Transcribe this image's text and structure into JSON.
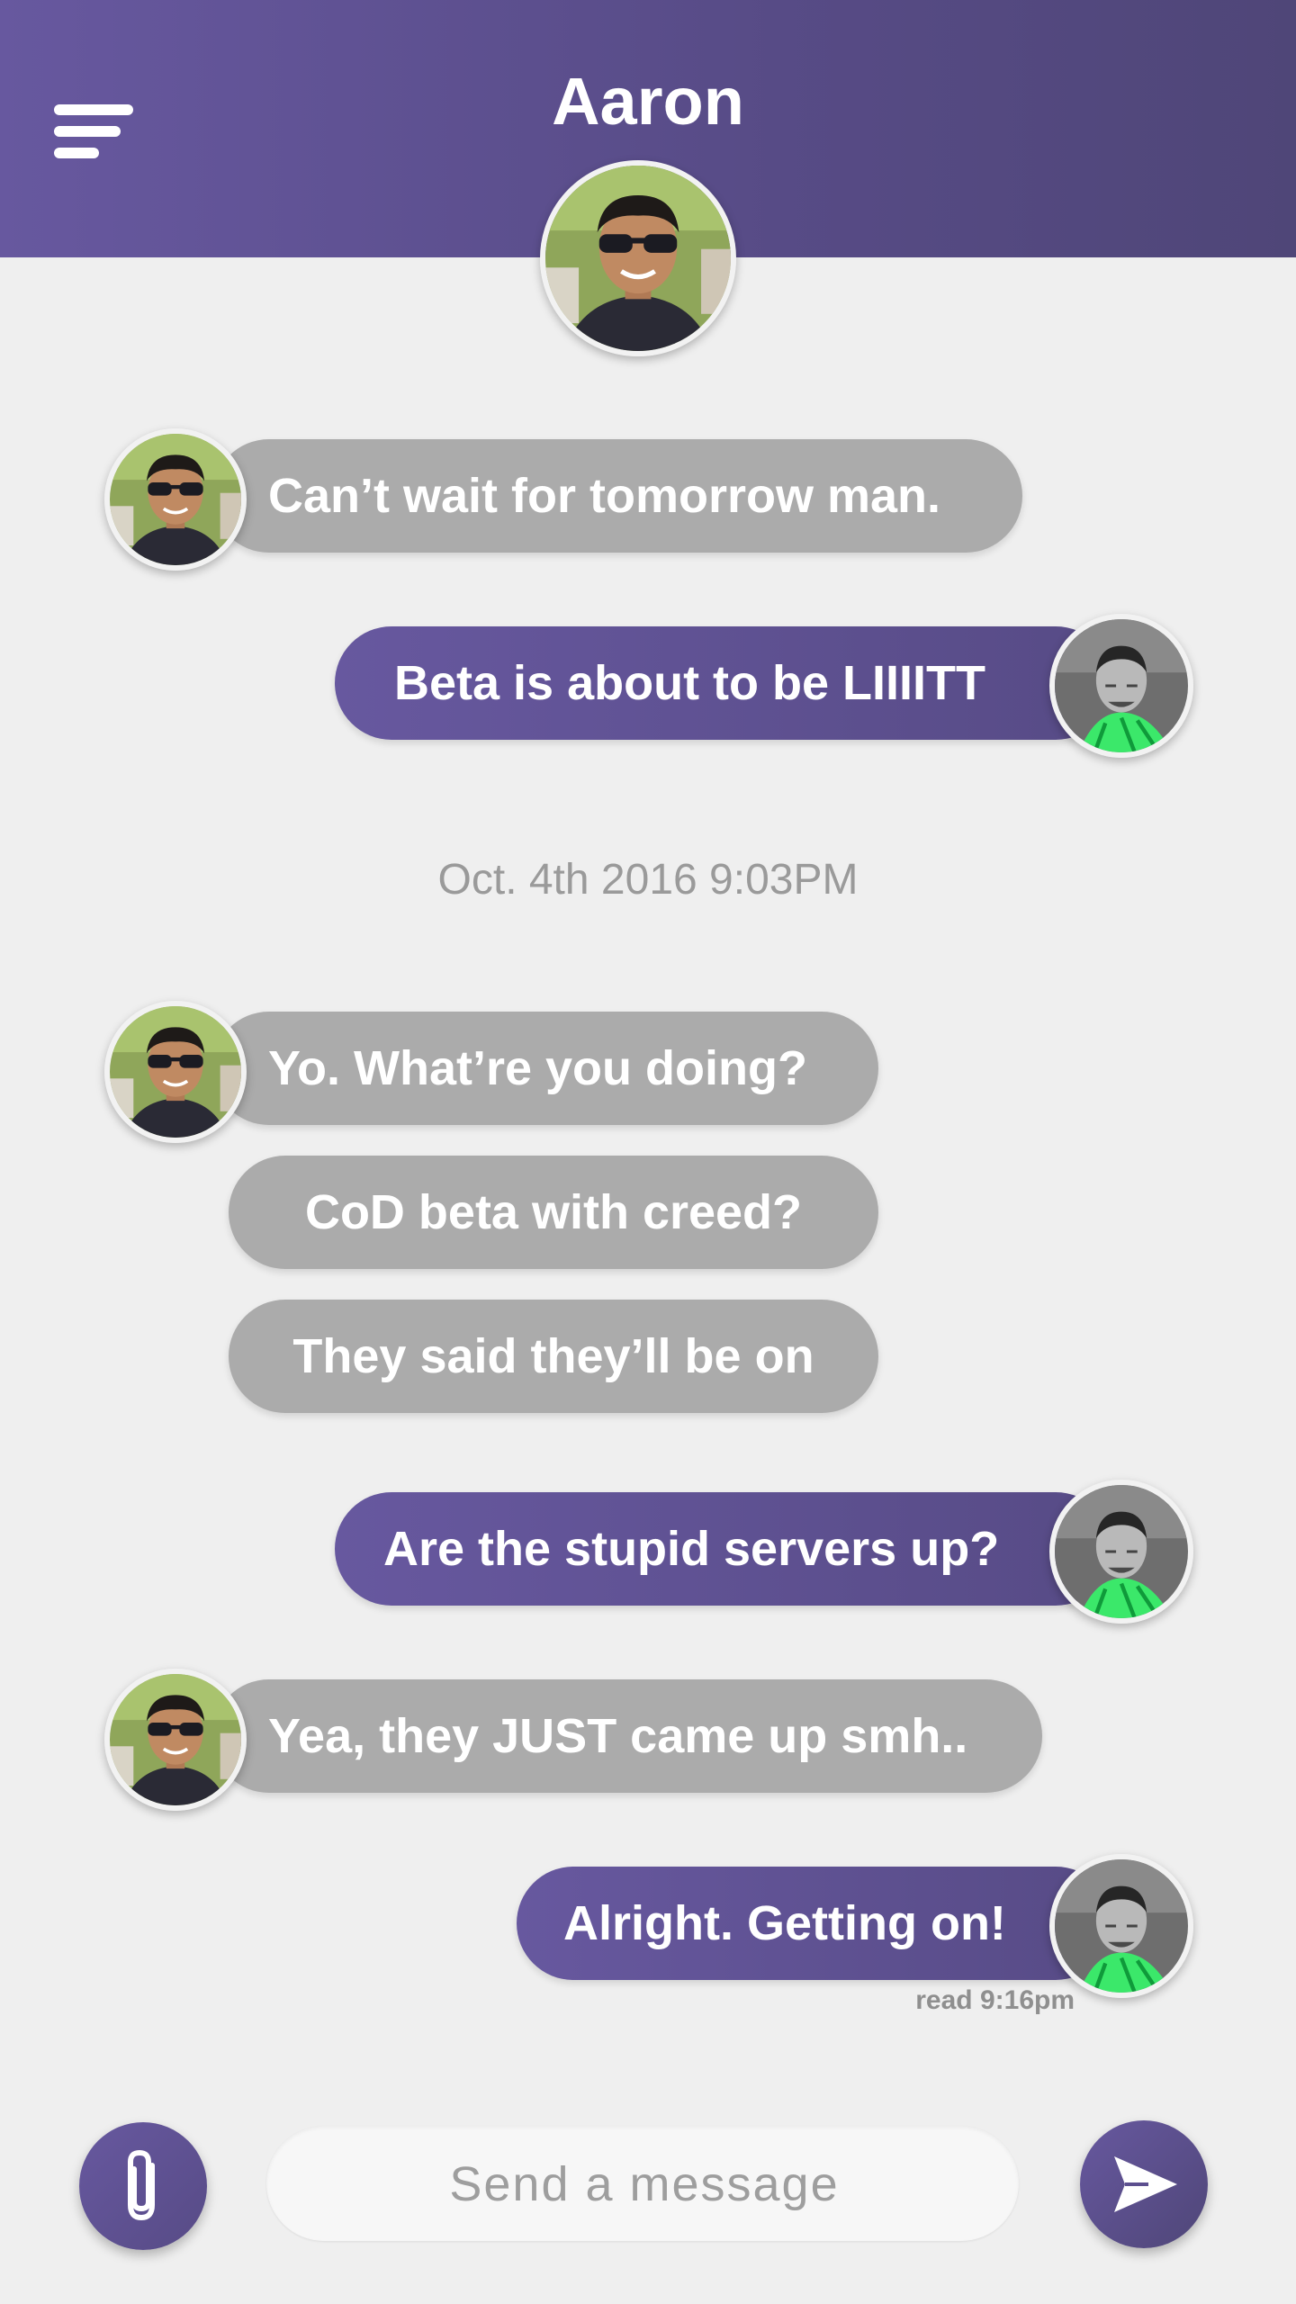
{
  "header": {
    "title": "Aaron",
    "menu_icon": "hamburger-menu-icon",
    "gradient": [
      "#67589f",
      "#4f4678"
    ]
  },
  "conversation": {
    "timestamp": "Oct. 4th 2016 9:03PM",
    "messages": [
      {
        "sender": "Aaron",
        "direction": "incoming",
        "text": "Can’t wait for tomorrow man."
      },
      {
        "sender": "me",
        "direction": "outgoing",
        "text": "Beta is about to be LIIIITT"
      },
      {
        "sender": "Aaron",
        "direction": "incoming",
        "text": "Yo. What’re you doing?"
      },
      {
        "sender": "Aaron",
        "direction": "incoming",
        "text": "CoD beta with creed?"
      },
      {
        "sender": "Aaron",
        "direction": "incoming",
        "text": "They said they’ll be on"
      },
      {
        "sender": "me",
        "direction": "outgoing",
        "text": "Are the stupid servers up?"
      },
      {
        "sender": "Aaron",
        "direction": "incoming",
        "text": "Yea, they JUST came up smh.."
      },
      {
        "sender": "me",
        "direction": "outgoing",
        "text": "Alright. Getting on!"
      }
    ],
    "read_receipt": "read 9:16pm"
  },
  "composer": {
    "placeholder": "Send a message",
    "value": "",
    "attach_icon": "paperclip-icon",
    "send_icon": "paper-plane-send-icon"
  },
  "colors": {
    "accent": "#5c4f8f",
    "incoming_bubble": "#ababab",
    "background": "#efefef",
    "timestamp_text": "#9a9a9a"
  }
}
